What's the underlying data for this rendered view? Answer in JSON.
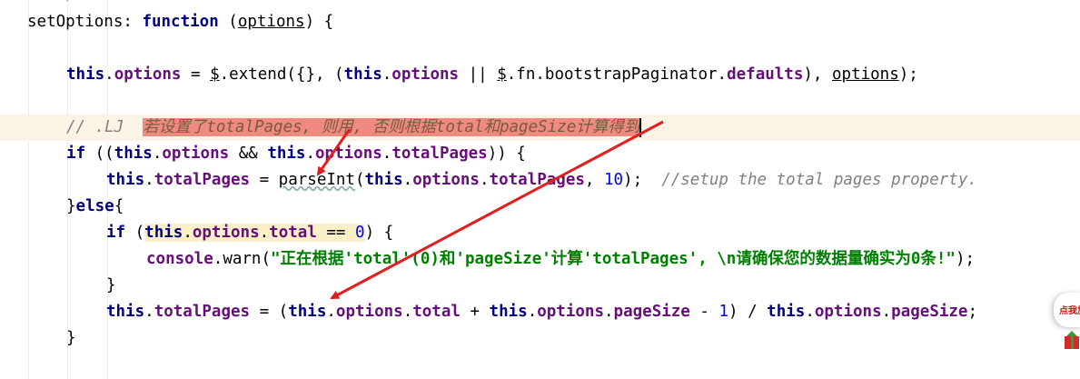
{
  "code": {
    "line_top_fragment": ")",
    "l1": {
      "a": "setOptions",
      "b": ": ",
      "kw": "function",
      "c": " (",
      "param": "options",
      "d": ") {"
    },
    "l2": {
      "this1": "this",
      "dot1": ".",
      "opt1": "options",
      "eq": " = ",
      "dollar": "$",
      "ext": ".extend({}, (",
      "this2": "this",
      "dot2": ".",
      "opt2": "options",
      "or": " || ",
      "dollar2": "$",
      "fn": ".fn.bootstrapPaginator.",
      "def": "defaults",
      "tail1": "), ",
      "param": "options",
      "tail2": ");"
    },
    "l3": {
      "comment": "// .LJ  ",
      "selected": "若设置了totalPages, 则用, 否则根据total和pageSize计算得到"
    },
    "l4": {
      "kw": "if",
      "a": " ((",
      "this1": "this",
      "b": ".",
      "opt1": "options",
      "c": " && ",
      "this2": "this",
      "d": ".",
      "opt2": "options",
      "e": ".",
      "tp": "totalPages",
      "f": ")) {"
    },
    "l5": {
      "this1": "this",
      "a": ".",
      "tp": "totalPages",
      "b": " = ",
      "fnc": "parseInt",
      "c": "(",
      "this2": "this",
      "d": ".",
      "opt": "options",
      "e": ".",
      "tp2": "totalPages",
      "f": ", ",
      "num": "10",
      "g": ");  ",
      "cmt": "//setup the total pages property."
    },
    "l6": {
      "a": "}",
      "kw": "else",
      "b": "{"
    },
    "l7": {
      "kw": "if",
      "a": " (",
      "this1": "this",
      "b": ".",
      "opt": "options",
      "c": ".",
      "tot": "total",
      "d": " == ",
      "num": "0",
      "e": ") {"
    },
    "l8": {
      "obj": "console",
      "a": ".",
      "m": "warn",
      "b": "(",
      "str": "\"正在根据'total'(0)和'pageSize'计算'totalPages', \\n请确保您的数据量确实为0条!\"",
      "c": ");"
    },
    "l9": {
      "a": "}"
    },
    "l10": {
      "this1": "this",
      "a": ".",
      "tp": "totalPages",
      "b": " = (",
      "this2": "this",
      "c": ".",
      "opt1": "options",
      "d": ".",
      "tot": "total",
      "e": " + ",
      "this3": "this",
      "f": ".",
      "opt2": "options",
      "g": ".",
      "ps1": "pageSize",
      "h": " - ",
      "num": "1",
      "i": ") / ",
      "this4": "this",
      "j": ".",
      "opt3": "options",
      "k": ".",
      "ps2": "pageSize",
      "l": ";"
    },
    "l11": {
      "a": "}"
    }
  },
  "badge": {
    "text": "点我加"
  },
  "colors": {
    "keyword": "#000080",
    "field": "#660e7a",
    "string": "#008000",
    "comment": "#808080",
    "number": "#0000ff",
    "selection": "#f08a80",
    "arrow": "#e02020"
  }
}
